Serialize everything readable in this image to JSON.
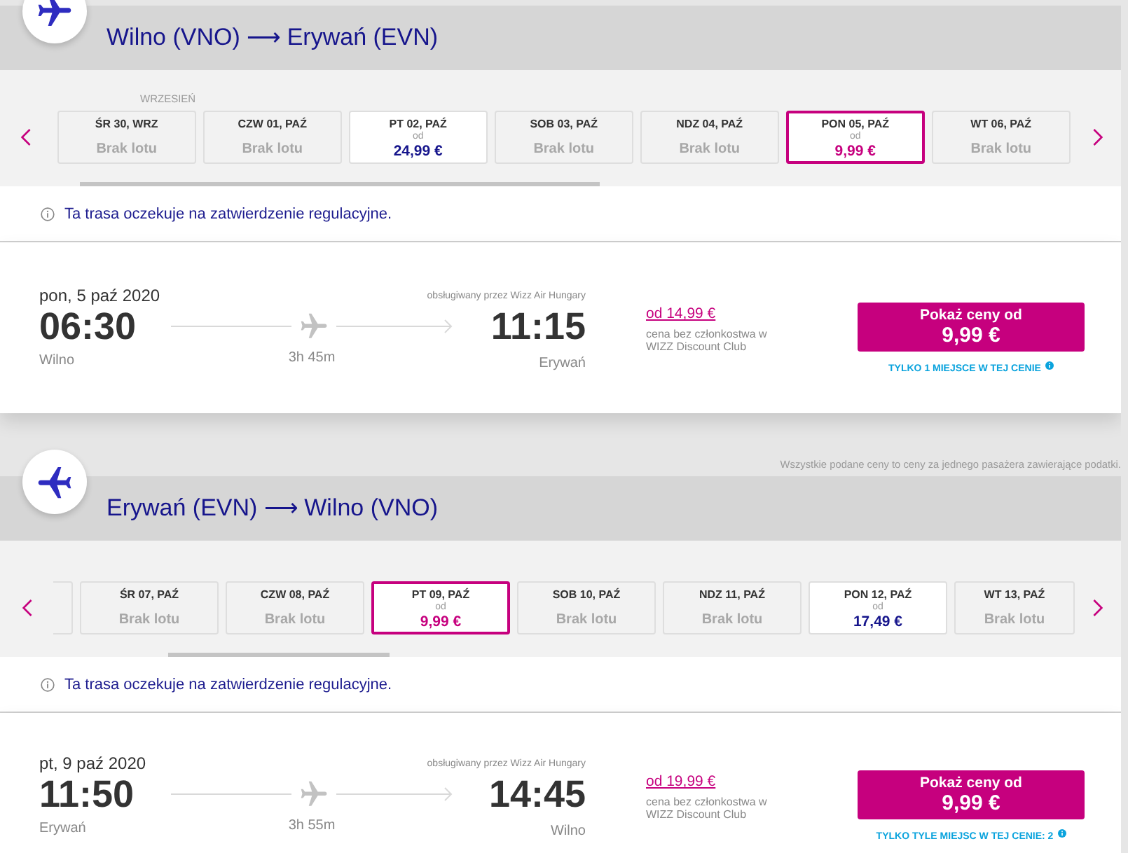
{
  "sections": [
    {
      "kind": "outbound",
      "title": "Wilno (VNO) ⟶ Erywań (EVN)",
      "month_label": "WRZESIEŃ",
      "partial_card_before": false,
      "dates": [
        {
          "label": "ŚR 30, WRZ",
          "kind": "no_flight",
          "status": "Brak lotu",
          "selected": false
        },
        {
          "label": "CZW 01, PAŹ",
          "kind": "no_flight",
          "status": "Brak lotu",
          "selected": false
        },
        {
          "label": "PT 02, PAŹ",
          "kind": "price",
          "prefix": "od",
          "price": "24,99 €",
          "selected": false
        },
        {
          "label": "SOB 03, PAŹ",
          "kind": "no_flight",
          "status": "Brak lotu",
          "selected": false
        },
        {
          "label": "NDZ 04, PAŹ",
          "kind": "no_flight",
          "status": "Brak lotu",
          "selected": false
        },
        {
          "label": "PON 05, PAŹ",
          "kind": "price",
          "prefix": "od",
          "price": "9,99 €",
          "selected": true
        },
        {
          "label": "WT 06, PAŹ",
          "kind": "no_flight",
          "status": "Brak lotu",
          "selected": false
        }
      ],
      "notice": "Ta trasa oczekuje na zatwierdzenie regulacyjne.",
      "flight": {
        "date": "pon, 5 paź 2020",
        "operator": "obsługiwany przez Wizz Air Hungary",
        "departure_time": "06:30",
        "departure_city": "Wilno",
        "duration": "3h 45m",
        "arrival_time": "11:15",
        "arrival_city": "Erywań",
        "member_price": "od 14,99 €",
        "price_note": "cena bez członkostwa w WIZZ Discount Club",
        "button": {
          "label": "Pokaż ceny od",
          "price": "9,99 €"
        },
        "seats": "TYLKO 1 MIEJSCE W TEJ CENIE"
      }
    },
    {
      "kind": "return",
      "disclaimer": "Wszystkie podane ceny to ceny za jednego pasażera zawierające podatki.",
      "title": "Erywań (EVN) ⟶ Wilno (VNO)",
      "partial_card_before": true,
      "dates": [
        {
          "label": "ŚR 07, PAŹ",
          "kind": "no_flight",
          "status": "Brak lotu",
          "selected": false
        },
        {
          "label": "CZW 08, PAŹ",
          "kind": "no_flight",
          "status": "Brak lotu",
          "selected": false
        },
        {
          "label": "PT 09, PAŹ",
          "kind": "price",
          "prefix": "od",
          "price": "9,99 €",
          "selected": true
        },
        {
          "label": "SOB 10, PAŹ",
          "kind": "no_flight",
          "status": "Brak lotu",
          "selected": false
        },
        {
          "label": "NDZ 11, PAŹ",
          "kind": "no_flight",
          "status": "Brak lotu",
          "selected": false
        },
        {
          "label": "PON 12, PAŹ",
          "kind": "price",
          "prefix": "od",
          "price": "17,49 €",
          "selected": false
        },
        {
          "label": "WT 13, PAŹ",
          "kind": "no_flight",
          "status": "Brak lotu",
          "selected": false
        }
      ],
      "notice": "Ta trasa oczekuje na zatwierdzenie regulacyjne.",
      "flight": {
        "date": "pt, 9 paź 2020",
        "operator": "obsługiwany przez Wizz Air Hungary",
        "departure_time": "11:50",
        "departure_city": "Erywań",
        "duration": "3h 55m",
        "arrival_time": "14:45",
        "arrival_city": "Wilno",
        "member_price": "od 19,99 €",
        "price_note": "cena bez członkostwa w WIZZ Discount Club",
        "button": {
          "label": "Pokaż ceny od",
          "price": "9,99 €"
        },
        "seats": "TYLKO TYLE MIEJSC W TEJ CENIE: 2"
      }
    }
  ]
}
